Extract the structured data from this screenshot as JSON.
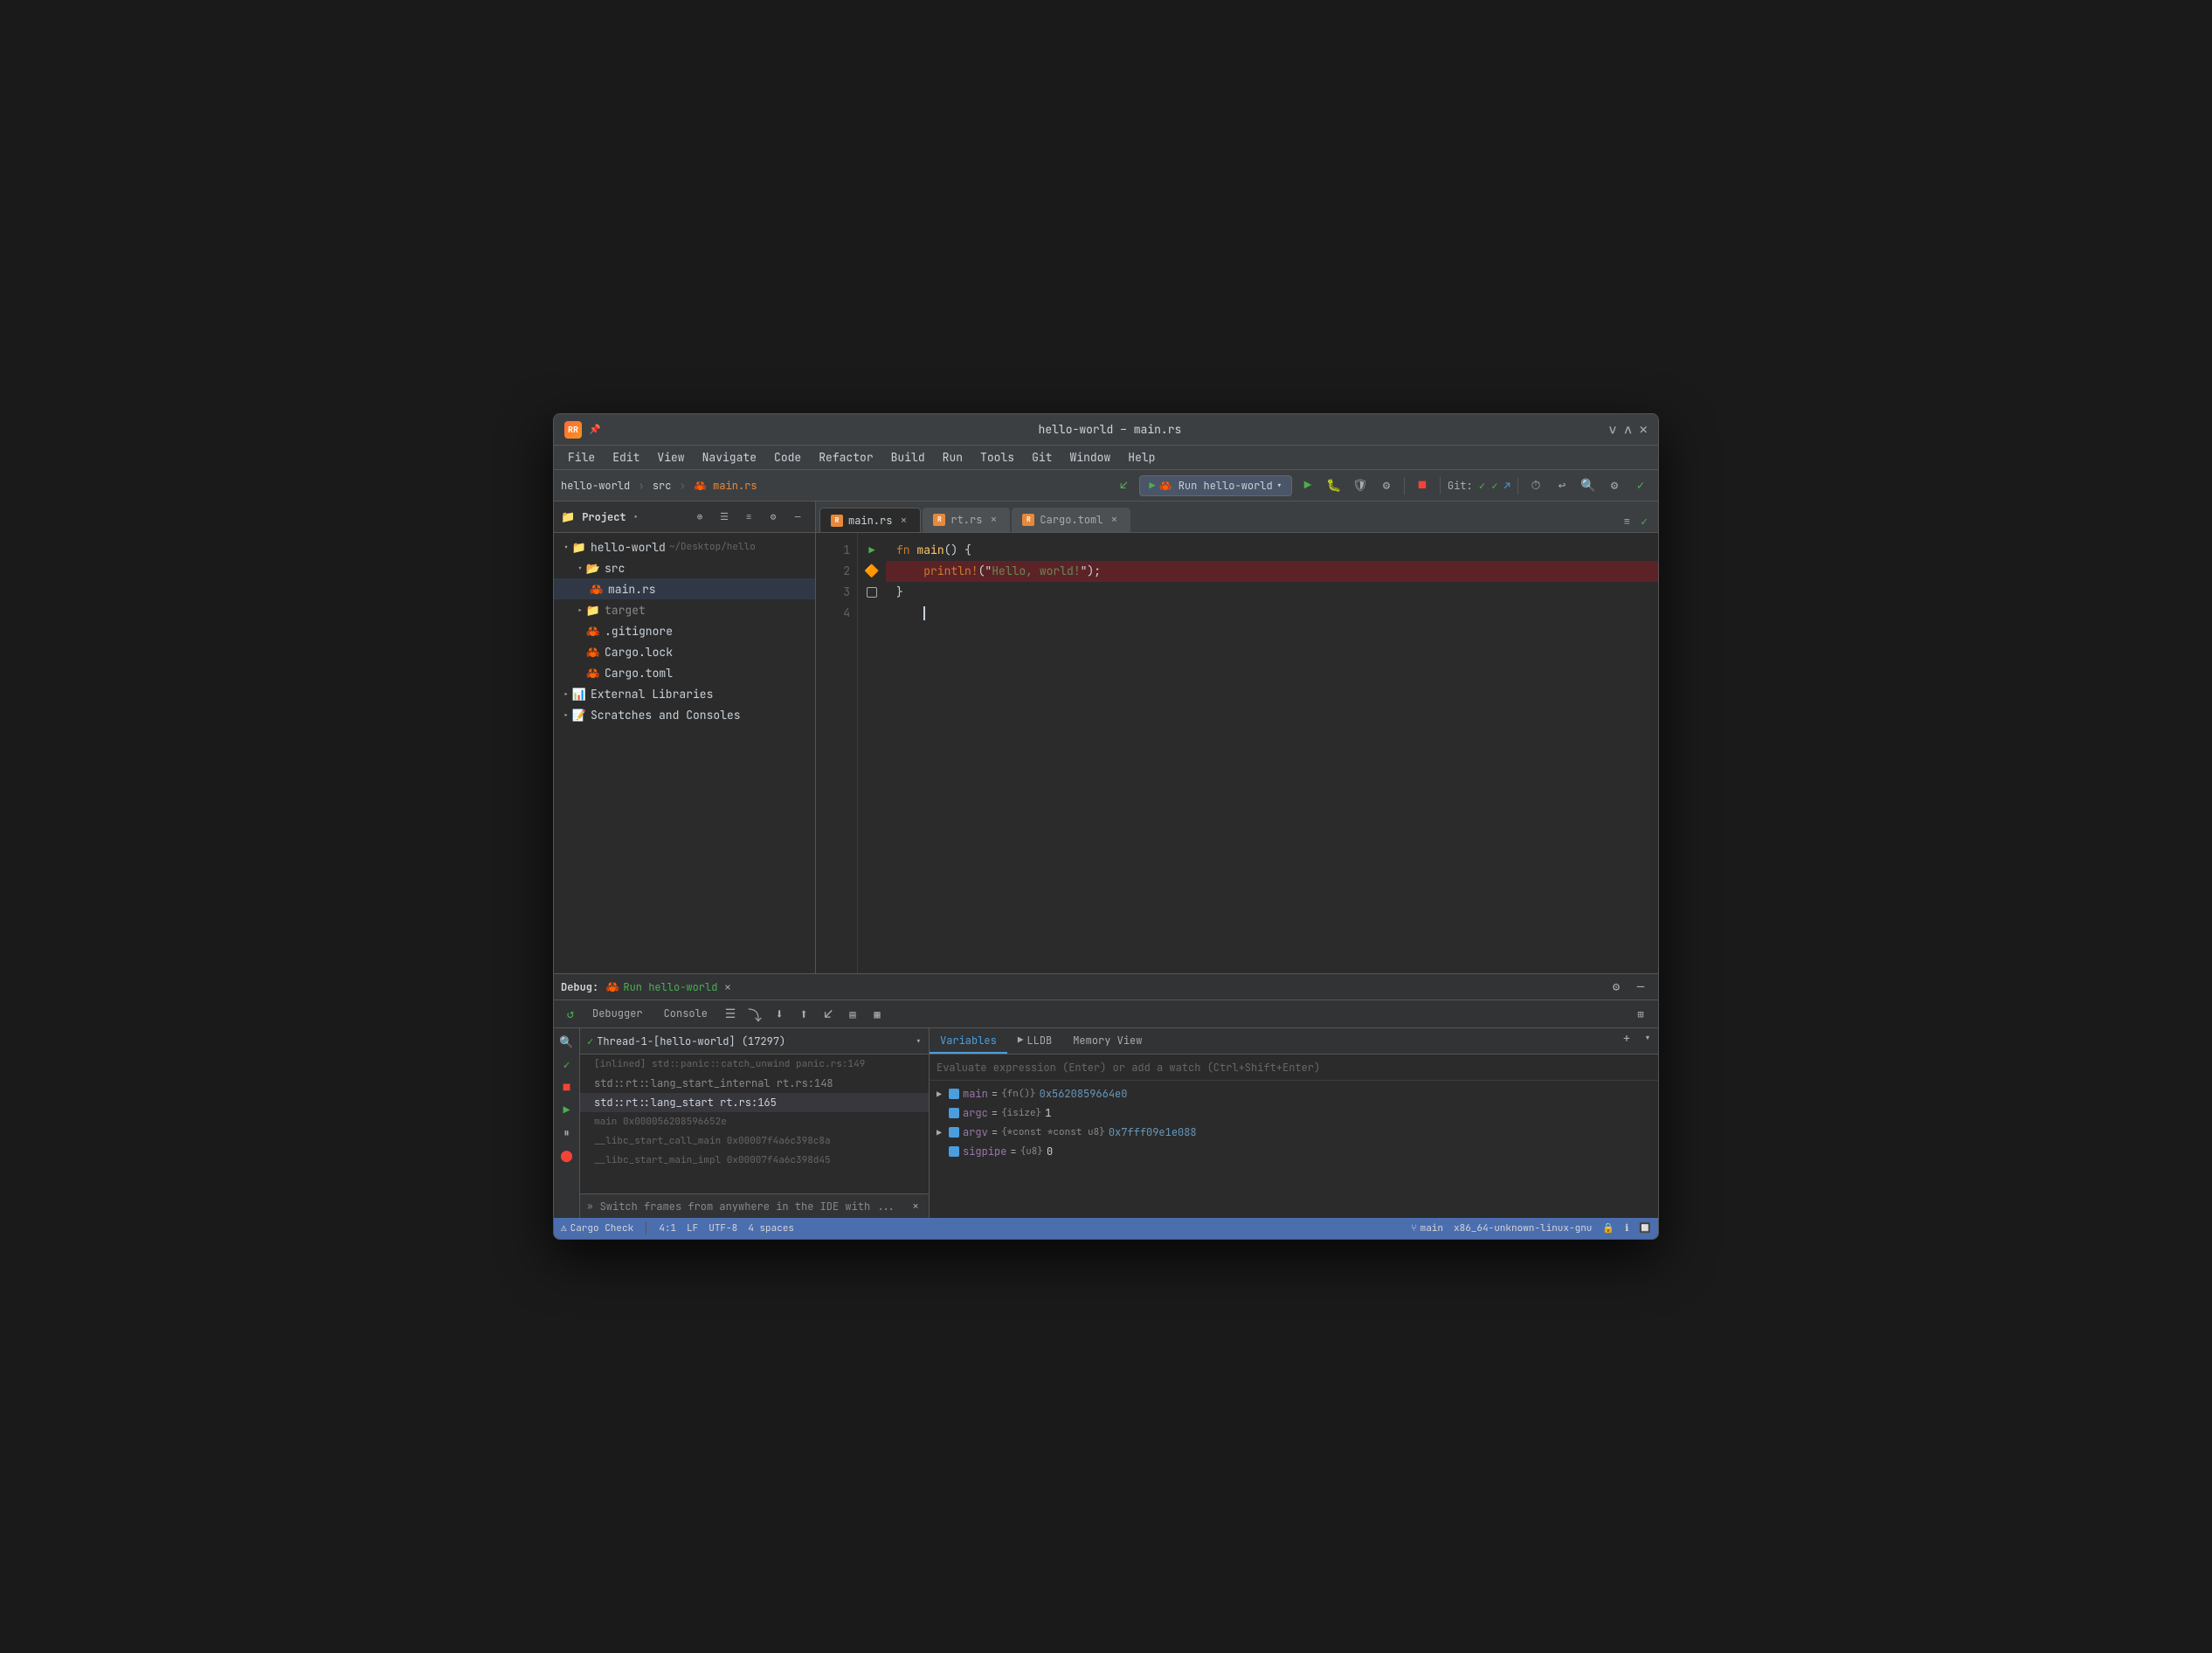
{
  "window": {
    "title": "hello-world – main.rs",
    "logo": "RR"
  },
  "menu": {
    "items": [
      "File",
      "Edit",
      "View",
      "Navigate",
      "Code",
      "Refactor",
      "Build",
      "Run",
      "Tools",
      "Git",
      "Window",
      "Help"
    ]
  },
  "toolbar": {
    "breadcrumb": {
      "project": "hello-world",
      "sep1": "›",
      "src": "src",
      "sep2": "›",
      "file": "main.rs"
    },
    "run_button": "Run hello-world"
  },
  "sidebar": {
    "title": "Project",
    "root": {
      "name": "hello-world",
      "path": "~/Desktop/hello",
      "items": [
        {
          "id": "src",
          "label": "src",
          "type": "folder-src",
          "expanded": true,
          "indent": 1
        },
        {
          "id": "main.rs",
          "label": "main.rs",
          "type": "rust",
          "indent": 2,
          "active": true
        },
        {
          "id": "target",
          "label": "target",
          "type": "folder",
          "indent": 1,
          "expanded": false
        },
        {
          "id": ".gitignore",
          "label": ".gitignore",
          "type": "gitignore",
          "indent": 1
        },
        {
          "id": "Cargo.lock",
          "label": "Cargo.lock",
          "type": "toml",
          "indent": 1
        },
        {
          "id": "Cargo.toml",
          "label": "Cargo.toml",
          "type": "toml",
          "indent": 1
        }
      ]
    },
    "external_libraries": "External Libraries",
    "scratches": "Scratches and Consoles"
  },
  "editor": {
    "tabs": [
      {
        "id": "main.rs",
        "label": "main.rs",
        "type": "rs",
        "active": true,
        "closeable": true
      },
      {
        "id": "rt.rs",
        "label": "rt.rs",
        "type": "rs",
        "active": false,
        "closeable": true
      },
      {
        "id": "Cargo.toml",
        "label": "Cargo.toml",
        "type": "toml",
        "active": false,
        "closeable": true
      }
    ],
    "code": {
      "lines": [
        {
          "num": 1,
          "gutter": "▶",
          "gutter_type": "run",
          "text": "fn main() {",
          "tokens": [
            {
              "t": "kw",
              "v": "fn"
            },
            {
              "t": "sp",
              "v": " "
            },
            {
              "t": "fn",
              "v": "main"
            },
            {
              "t": "punc",
              "v": "() {"
            }
          ]
        },
        {
          "num": 2,
          "gutter": "🔶",
          "gutter_type": "debug",
          "text": "    println!(\"Hello, world!\");",
          "highlighted": true,
          "tokens": [
            {
              "t": "sp",
              "v": "    "
            },
            {
              "t": "macro",
              "v": "println!"
            },
            {
              "t": "punc",
              "v": "(\""
            },
            {
              "t": "str",
              "v": "Hello, world!"
            },
            {
              "t": "punc",
              "v": "\");"
            }
          ]
        },
        {
          "num": 3,
          "gutter": "",
          "gutter_type": "none",
          "text": "}",
          "tokens": [
            {
              "t": "punc",
              "v": "}"
            }
          ]
        },
        {
          "num": 4,
          "gutter": "",
          "gutter_type": "none",
          "text": "    ",
          "cursor": true
        }
      ]
    }
  },
  "debug": {
    "panel_title": "Debug:",
    "run_name": "Run hello-world",
    "tabs": [
      {
        "id": "debugger",
        "label": "Debugger",
        "active": false
      },
      {
        "id": "console",
        "label": "Console",
        "active": false
      }
    ],
    "thread_selector": {
      "label": "Thread-1-[hello-world] (17297)"
    },
    "frames": [
      {
        "id": 1,
        "text": "[inlined] std::panic::catch_unwind panic.rs:149",
        "dimmed": true,
        "selected": false
      },
      {
        "id": 2,
        "text": "std::rt::lang_start_internal rt.rs:148",
        "dimmed": false,
        "selected": false
      },
      {
        "id": 3,
        "text": "std::rt::lang_start rt.rs:165",
        "dimmed": false,
        "selected": true
      },
      {
        "id": 4,
        "text": "main 0x000056208596652e",
        "dimmed": true,
        "selected": false
      },
      {
        "id": 5,
        "text": "__libc_start_call_main 0x00007f4a6c398c8a",
        "dimmed": true,
        "selected": false
      },
      {
        "id": 6,
        "text": "__libc_start_main_impl 0x00007f4a6c398d45",
        "dimmed": true,
        "selected": false
      }
    ],
    "var_tabs": [
      "Variables",
      "LLDB",
      "Memory View"
    ],
    "eval_placeholder": "Evaluate expression (Enter) or add a watch (Ctrl+Shift+Enter)",
    "variables": [
      {
        "id": "main",
        "name": "main",
        "type": "fn()",
        "value": "0x5620859664e0",
        "expandable": true,
        "color": "#4b9edd"
      },
      {
        "id": "argc",
        "name": "argc",
        "type": "{isize}",
        "value": "1",
        "expandable": false,
        "color": "#4b9edd"
      },
      {
        "id": "argv",
        "name": "argv",
        "type": "{*const *const u8}",
        "value": "0x7fff09e1e088",
        "expandable": true,
        "color": "#4b9edd"
      },
      {
        "id": "sigpipe",
        "name": "sigpipe",
        "type": "{u8}",
        "value": "0",
        "expandable": false,
        "color": "#4b9edd"
      }
    ],
    "bottom_frame": "Switch frames from anywhere in the IDE with ..."
  },
  "status_bar": {
    "cargo_check": "Cargo Check",
    "position": "4:1",
    "line_ending": "LF",
    "encoding": "UTF-8",
    "indent": "4 spaces",
    "branch": "main",
    "arch": "x86_64-unknown-linux-gnu"
  }
}
